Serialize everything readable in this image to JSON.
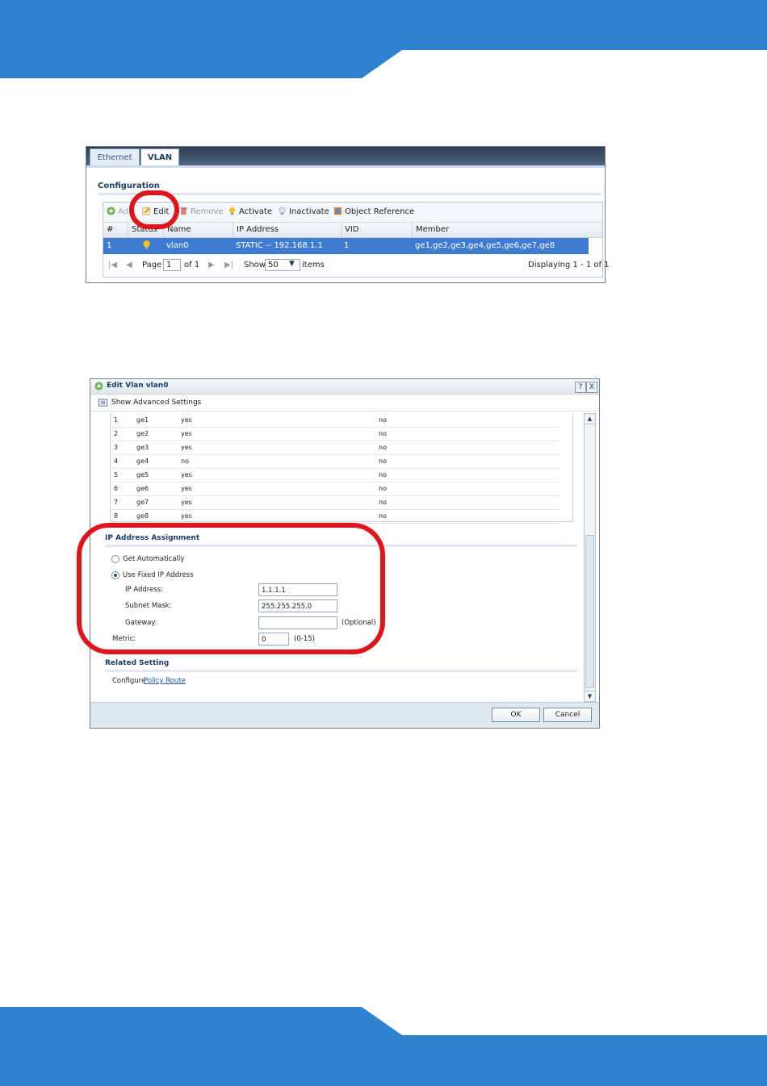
{
  "colors": {
    "band": "#2f82cf",
    "highlight": "#e0141b",
    "selected_row": "#3f7cd1"
  },
  "vlan_screen": {
    "tabs": [
      "Ethernet",
      "VLAN"
    ],
    "section": "Configuration",
    "toolbar": {
      "add": "Ad",
      "edit": "Edit",
      "remove": "Remove",
      "activate": "Activate",
      "inactivate": "Inactivate",
      "object_reference": "Object Reference"
    },
    "columns": [
      "#",
      "Status",
      "Name",
      "IP Address",
      "VID",
      "Member"
    ],
    "row": {
      "num": "1",
      "name": "vlan0",
      "ip": "STATIC -- 192.168.1.1",
      "vid": "1",
      "member": "ge1,ge2,ge3,ge4,ge5,ge6,ge7,ge8"
    },
    "pager": {
      "page_label": "Page",
      "page": "1",
      "of": "of 1",
      "show": "Show",
      "items_per_page": "50",
      "items": "items",
      "displaying": "Displaying 1 - 1 of 1"
    }
  },
  "edit_dialog": {
    "title": "Edit Vlan vlan0",
    "help": "?",
    "close": "X",
    "advanced": "Show Advanced Settings",
    "ports": [
      {
        "n": "1",
        "port": "ge1",
        "member": "yes",
        "tx": "no"
      },
      {
        "n": "2",
        "port": "ge2",
        "member": "yes",
        "tx": "no"
      },
      {
        "n": "3",
        "port": "ge3",
        "member": "yes",
        "tx": "no"
      },
      {
        "n": "4",
        "port": "ge4",
        "member": "no",
        "tx": "no"
      },
      {
        "n": "5",
        "port": "ge5",
        "member": "yes",
        "tx": "no"
      },
      {
        "n": "6",
        "port": "ge6",
        "member": "yes",
        "tx": "no"
      },
      {
        "n": "7",
        "port": "ge7",
        "member": "yes",
        "tx": "no"
      },
      {
        "n": "8",
        "port": "ge8",
        "member": "yes",
        "tx": "no"
      }
    ],
    "ip_section": "IP Address Assignment",
    "get_auto": "Get Automatically",
    "use_fixed": "Use Fixed IP Address",
    "ip_label": "IP Address:",
    "ip_value": "1.1.1.1",
    "mask_label": "Subnet Mask:",
    "mask_value": "255.255.255.0",
    "gw_label": "Gateway:",
    "gw_value": "",
    "optional": "(Optional)",
    "metric_label": "Metric:",
    "metric_value": "0",
    "metric_range": "(0-15)",
    "related": "Related Setting",
    "configure": "Configure",
    "policy_route": "Policy Route",
    "ok": "OK",
    "cancel": "Cancel"
  }
}
